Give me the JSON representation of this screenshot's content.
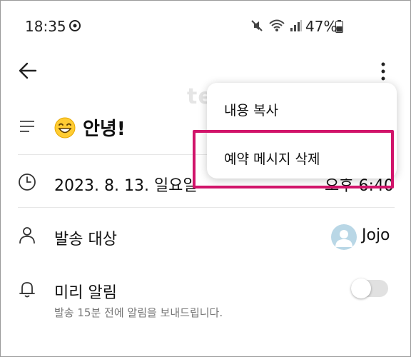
{
  "status_bar": {
    "time": "18:35",
    "battery": "47%"
  },
  "watermark": "techworld",
  "message": {
    "title": "안녕!",
    "date": "2023. 8. 13. 일요일",
    "time": "오후 6:40",
    "target_label": "발송 대상",
    "contact_name": "Jojo",
    "reminder_label": "미리 알림",
    "reminder_sub": "발송 15분 전에 알림을 보내드립니다.",
    "reminder_enabled": false
  },
  "menu": {
    "copy_label": "내용 복사",
    "delete_label": "예약 메시지 삭제"
  },
  "colors": {
    "highlight": "#d1146a",
    "avatar_bg": "#b9d7e6"
  }
}
